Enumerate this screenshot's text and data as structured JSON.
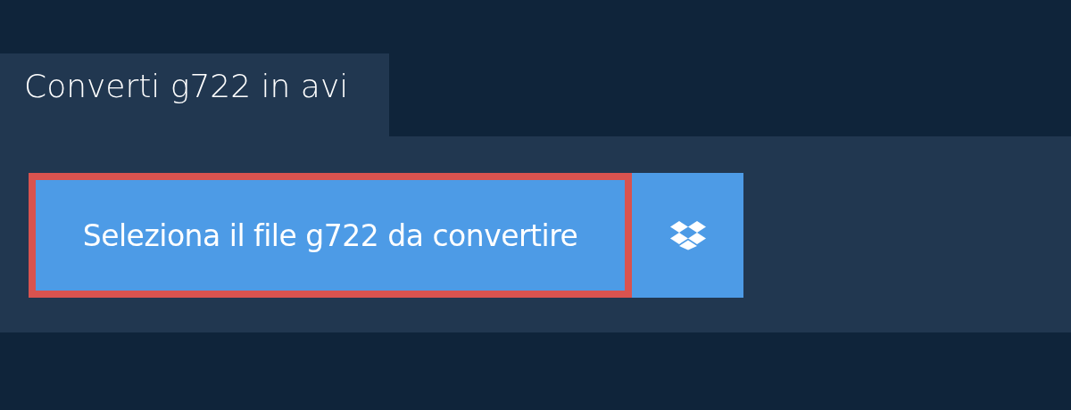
{
  "tab": {
    "label": "Converti g722 in avi"
  },
  "select_button": {
    "label": "Seleziona il file g722 da convertire",
    "highlighted": true
  }
}
